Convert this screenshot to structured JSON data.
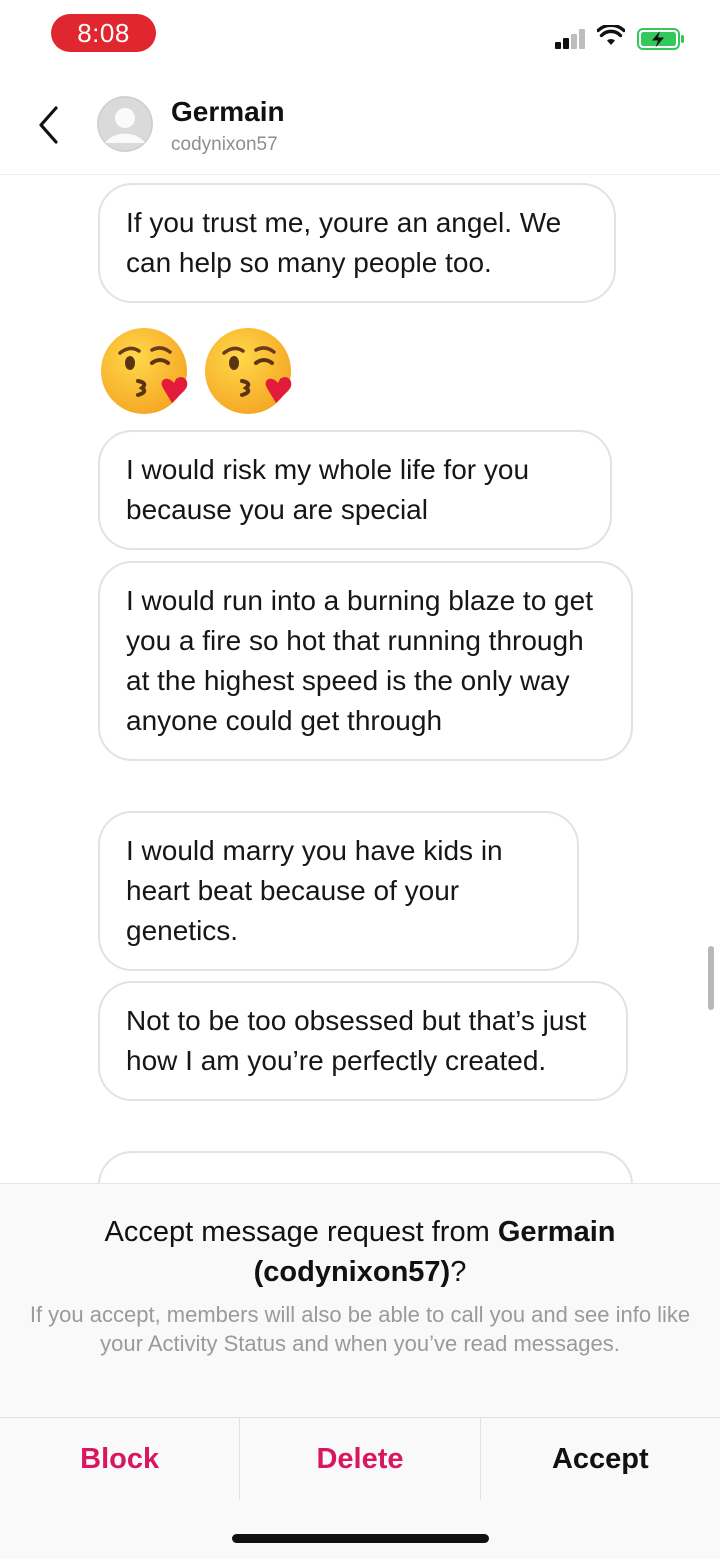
{
  "status_bar": {
    "time": "8:08",
    "time_pill_color": "#e0262f",
    "icons": [
      "cellular-signal-icon",
      "wifi-icon",
      "battery-charging-icon"
    ],
    "battery_color": "#34c759"
  },
  "header": {
    "name": "Germain",
    "username": "codynixon57",
    "icons": [
      "back-chevron-icon",
      "avatar-placeholder-icon"
    ]
  },
  "messages": [
    {
      "type": "text",
      "text": "If you trust me, youre an angel. We can help so many people too."
    },
    {
      "type": "emoji",
      "icon": "kissing-face-heart-emoji",
      "count": 2
    },
    {
      "type": "text",
      "text": "I would risk my whole life for you because you are special"
    },
    {
      "type": "text",
      "text": "I would run into a burning blaze to get you a fire so hot that running through at the highest speed is the only way anyone could get through"
    },
    {
      "type": "text",
      "text": "I would marry you have kids in heart beat because of your genetics."
    },
    {
      "type": "text",
      "text": "Not to be too obsessed but that’s just how I am you’re perfectly created."
    }
  ],
  "request": {
    "title_prefix": "Accept message request from ",
    "title_name": "Germain",
    "title_username": "(codynixon57)",
    "title_suffix": "?",
    "note": "If you accept, members will also be able to call you and see info like your Activity Status and when you’ve read messages."
  },
  "actions": {
    "block": "Block",
    "delete": "Delete",
    "accept": "Accept",
    "danger_color": "#d9175e"
  }
}
